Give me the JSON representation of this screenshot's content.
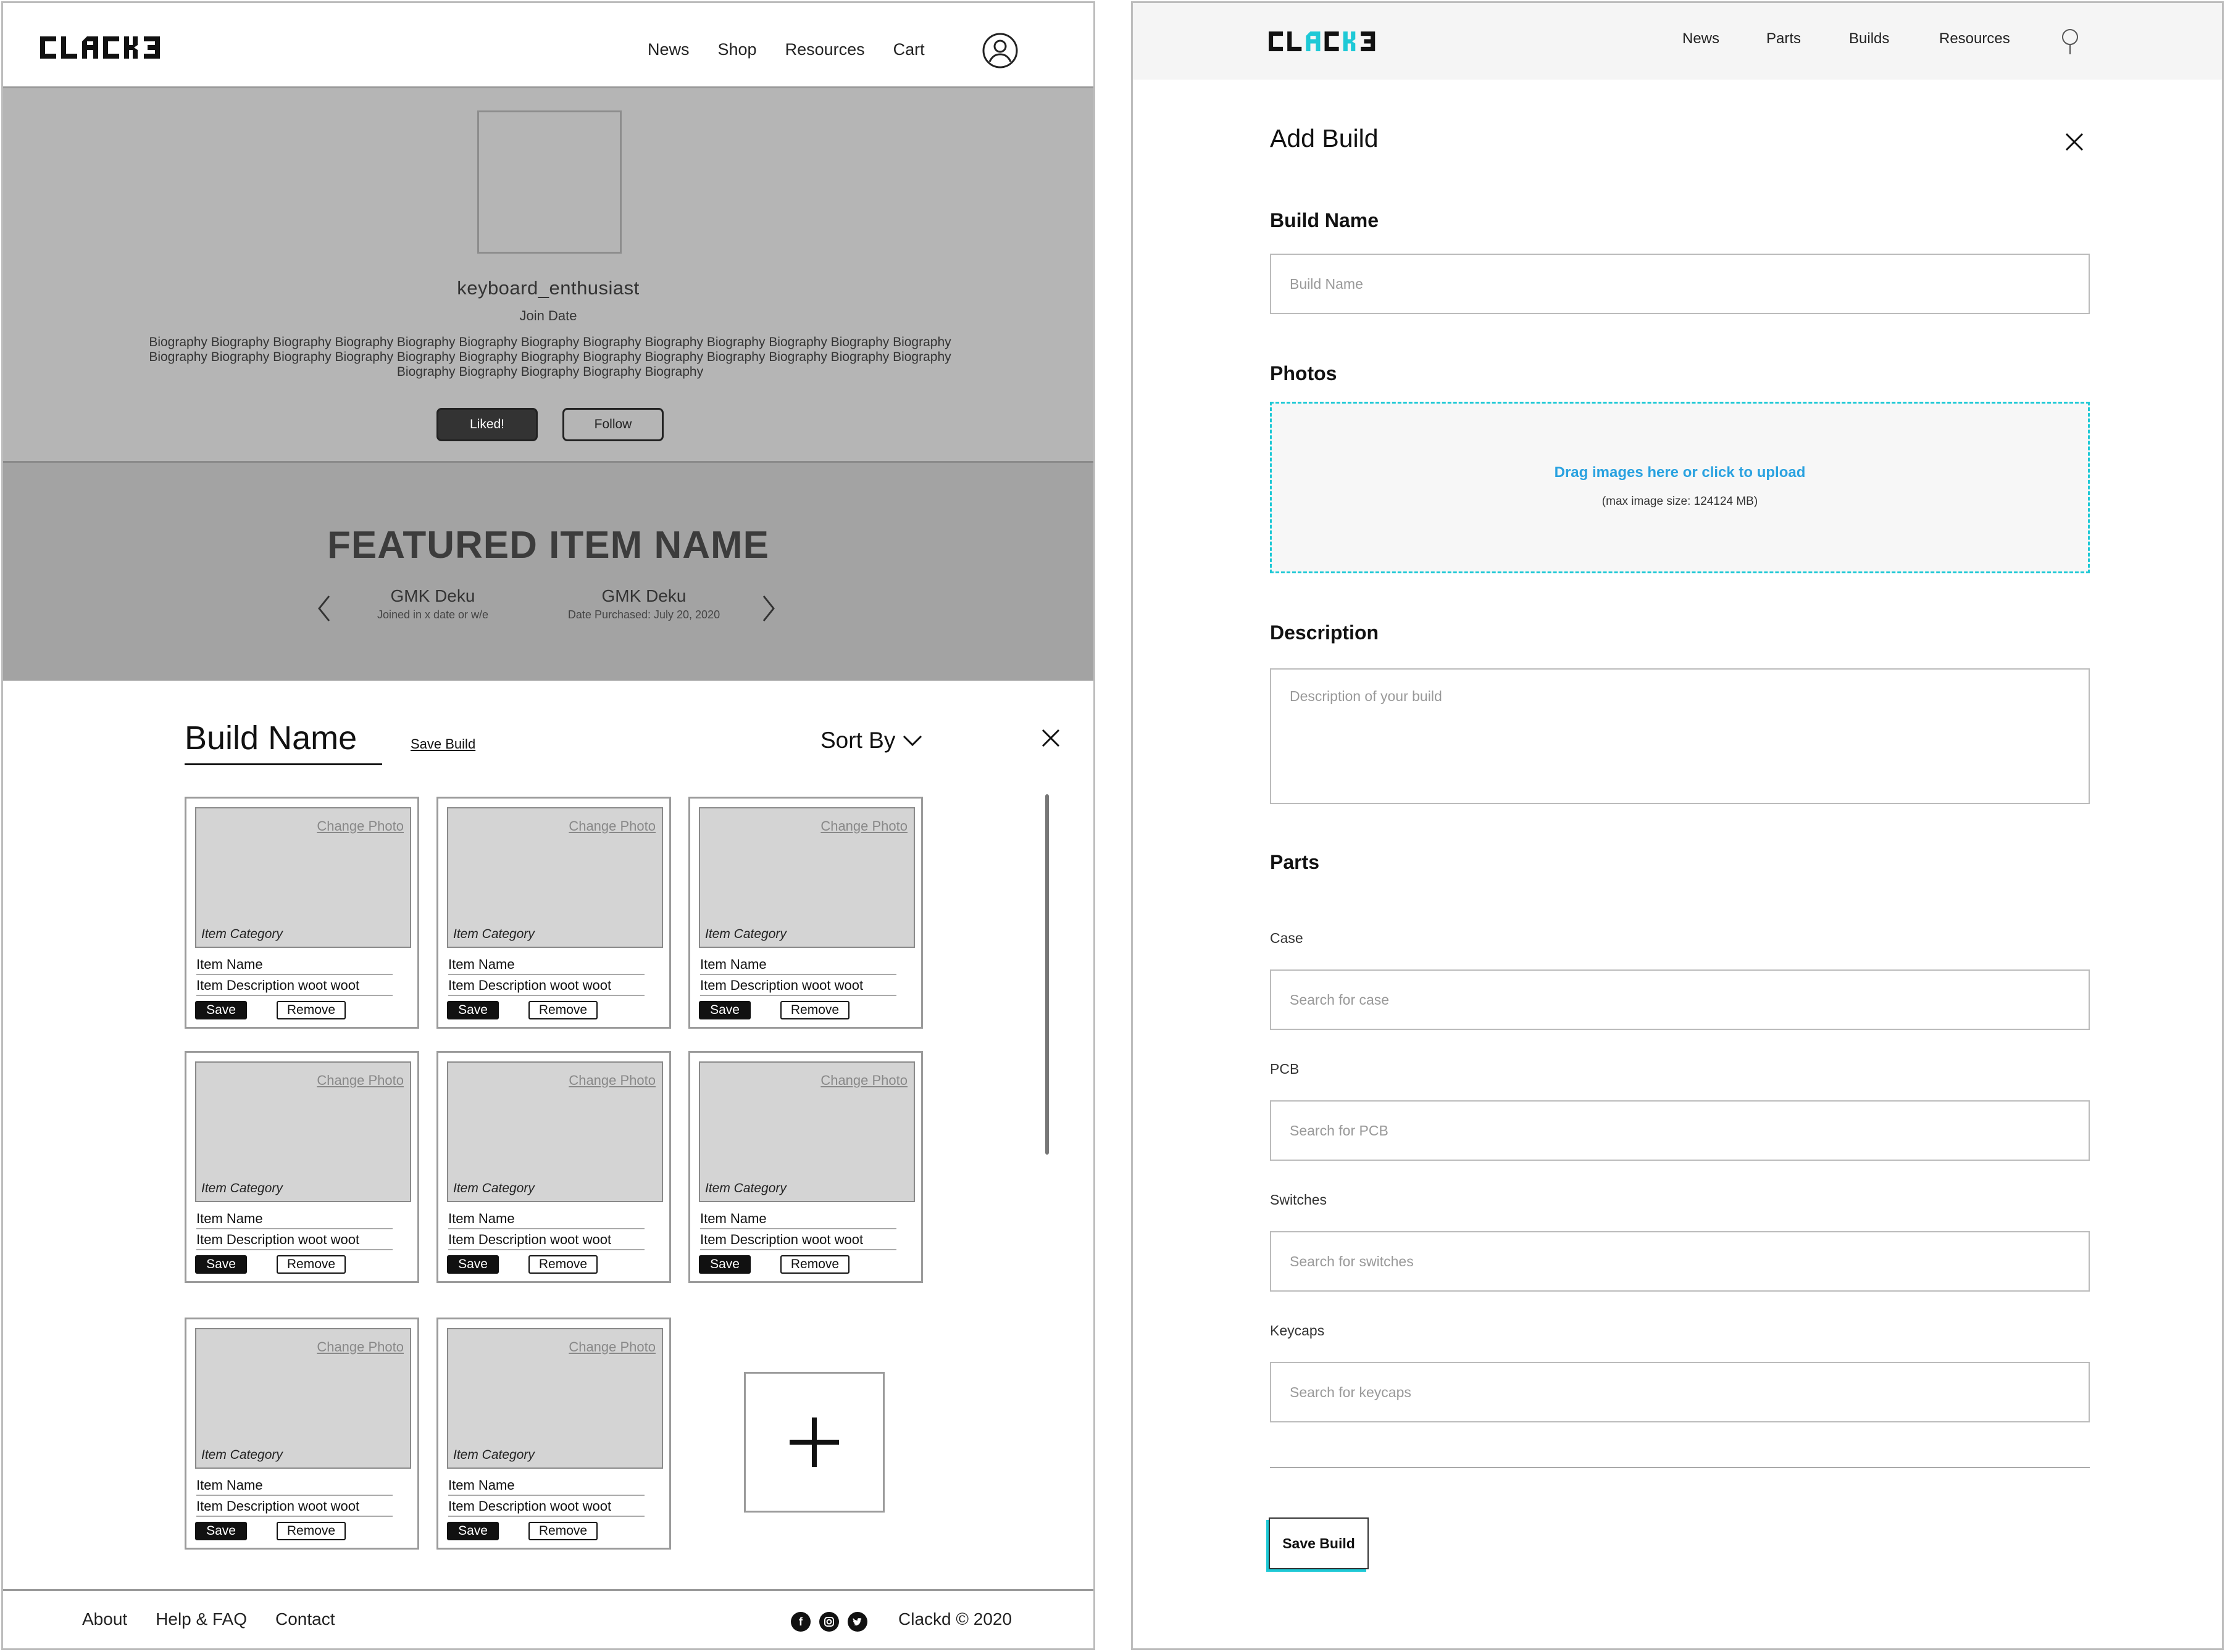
{
  "left": {
    "nav": [
      "News",
      "Shop",
      "Resources",
      "Cart"
    ],
    "profile": {
      "username": "keyboard_enthusiast",
      "join_date": "Join Date",
      "bio": "Biography Biography Biography Biography Biography Biography Biography Biography Biography Biography Biography Biography Biography Biography Biography Biography Biography Biography Biography Biography Biography Biography Biography Biography Biography Biography Biography Biography Biography Biography Biography",
      "liked_label": "Liked!",
      "follow_label": "Follow"
    },
    "featured": {
      "title": "FEATURED ITEM NAME",
      "items": [
        {
          "name": "GMK Deku",
          "detail": "Joined in x date or w/e"
        },
        {
          "name": "GMK Deku",
          "detail": "Date Purchased: July 20, 2020"
        }
      ]
    },
    "build": {
      "title": "Build Name",
      "save_link": "Save Build",
      "sort_label": "Sort By",
      "cards": [
        {
          "change": "Change Photo",
          "category": "Item Category",
          "name": "Item Name",
          "desc": "Item Description woot woot",
          "save": "Save",
          "remove": "Remove"
        },
        {
          "change": "Change Photo",
          "category": "Item Category",
          "name": "Item Name",
          "desc": "Item Description woot woot",
          "save": "Save",
          "remove": "Remove"
        },
        {
          "change": "Change Photo",
          "category": "Item Category",
          "name": "Item Name",
          "desc": "Item Description woot woot",
          "save": "Save",
          "remove": "Remove"
        },
        {
          "change": "Change Photo",
          "category": "Item Category",
          "name": "Item Name",
          "desc": "Item Description woot woot",
          "save": "Save",
          "remove": "Remove"
        },
        {
          "change": "Change Photo",
          "category": "Item Category",
          "name": "Item Name",
          "desc": "Item Description woot woot",
          "save": "Save",
          "remove": "Remove"
        },
        {
          "change": "Change Photo",
          "category": "Item Category",
          "name": "Item Name",
          "desc": "Item Description woot woot",
          "save": "Save",
          "remove": "Remove"
        },
        {
          "change": "Change Photo",
          "category": "Item Category",
          "name": "Item Name",
          "desc": "Item Description woot woot",
          "save": "Save",
          "remove": "Remove"
        },
        {
          "change": "Change Photo",
          "category": "Item Category",
          "name": "Item Name",
          "desc": "Item Description woot woot",
          "save": "Save",
          "remove": "Remove"
        }
      ]
    },
    "footer": {
      "links": [
        "About",
        "Help & FAQ",
        "Contact"
      ],
      "copyright": "Clackd © 2020",
      "social_icons": [
        "facebook-icon",
        "instagram-icon",
        "twitter-icon"
      ]
    }
  },
  "right": {
    "nav": [
      "News",
      "Parts",
      "Builds",
      "Resources"
    ],
    "title": "Add Build",
    "build_name": {
      "label": "Build Name",
      "placeholder": "Build Name"
    },
    "photos": {
      "label": "Photos",
      "cta": "Drag images here or click to upload",
      "hint": "(max image size: 124124 MB)"
    },
    "description": {
      "label": "Description",
      "placeholder": "Description of your build"
    },
    "parts": {
      "label": "Parts",
      "fields": [
        {
          "label": "Case",
          "placeholder": "Search for case"
        },
        {
          "label": "PCB",
          "placeholder": "Search for PCB"
        },
        {
          "label": "Switches",
          "placeholder": "Search for switches"
        },
        {
          "label": "Keycaps",
          "placeholder": "Search for keycaps"
        }
      ]
    },
    "save_label": "Save Build"
  },
  "colors": {
    "accent": "#1ec9d6",
    "link_blue": "#2aa2e0",
    "profile_bg": "#b5b5b5",
    "featured_bg": "#a3a3a3"
  }
}
